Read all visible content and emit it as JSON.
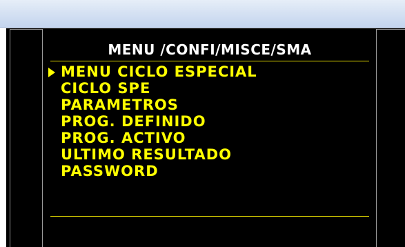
{
  "header": {
    "path": "MENU /CONFI/MISCE/SMA"
  },
  "menu": {
    "selected_index": 0,
    "items": [
      {
        "label": "MENU CICLO ESPECIAL"
      },
      {
        "label": "CICLO SPE"
      },
      {
        "label": "PARAMETROS"
      },
      {
        "label": "PROG. DEFINIDO"
      },
      {
        "label": "PROG. ACTIVO"
      },
      {
        "label": "ULTIMO RESULTADO"
      },
      {
        "label": "PASSWORD"
      }
    ]
  },
  "colors": {
    "background": "#000000",
    "menu_text": "#ffff00",
    "header_text": "#ffffff",
    "rule": "#e9e000",
    "titlebar": "#d6e2f3"
  },
  "icons": {
    "selection_cursor": "triangle-right-icon"
  }
}
